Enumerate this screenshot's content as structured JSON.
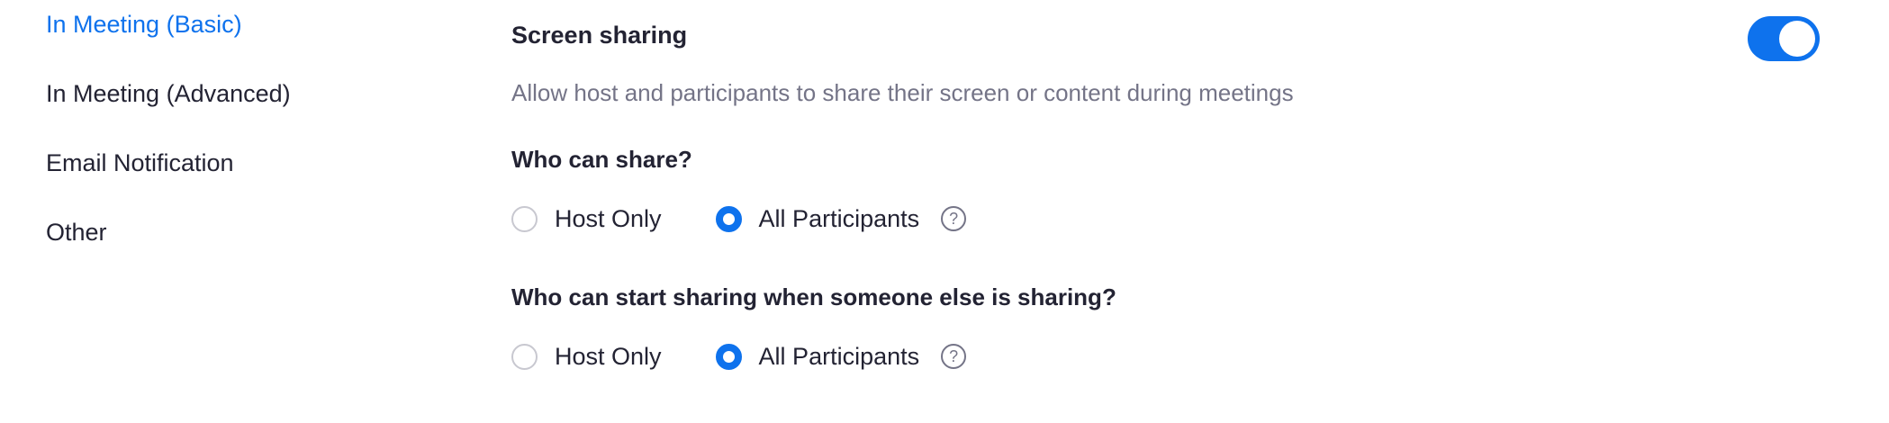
{
  "sidebar": {
    "items": [
      {
        "label": "In Meeting (Basic)",
        "active": true
      },
      {
        "label": "In Meeting (Advanced)",
        "active": false
      },
      {
        "label": "Email Notification",
        "active": false
      },
      {
        "label": "Other",
        "active": false
      }
    ]
  },
  "setting": {
    "title": "Screen sharing",
    "description": "Allow host and participants to share their screen or content during meetings",
    "enabled": true,
    "questions": [
      {
        "label": "Who can share?",
        "options": [
          {
            "label": "Host Only",
            "checked": false
          },
          {
            "label": "All Participants",
            "checked": true
          }
        ],
        "help_icon": "question-mark-icon"
      },
      {
        "label": "Who can start sharing when someone else is sharing?",
        "options": [
          {
            "label": "Host Only",
            "checked": false
          },
          {
            "label": "All Participants",
            "checked": true
          }
        ],
        "help_icon": "question-mark-icon"
      }
    ]
  },
  "colors": {
    "accent": "#0e72ed",
    "text": "#232333",
    "muted": "#747487"
  }
}
